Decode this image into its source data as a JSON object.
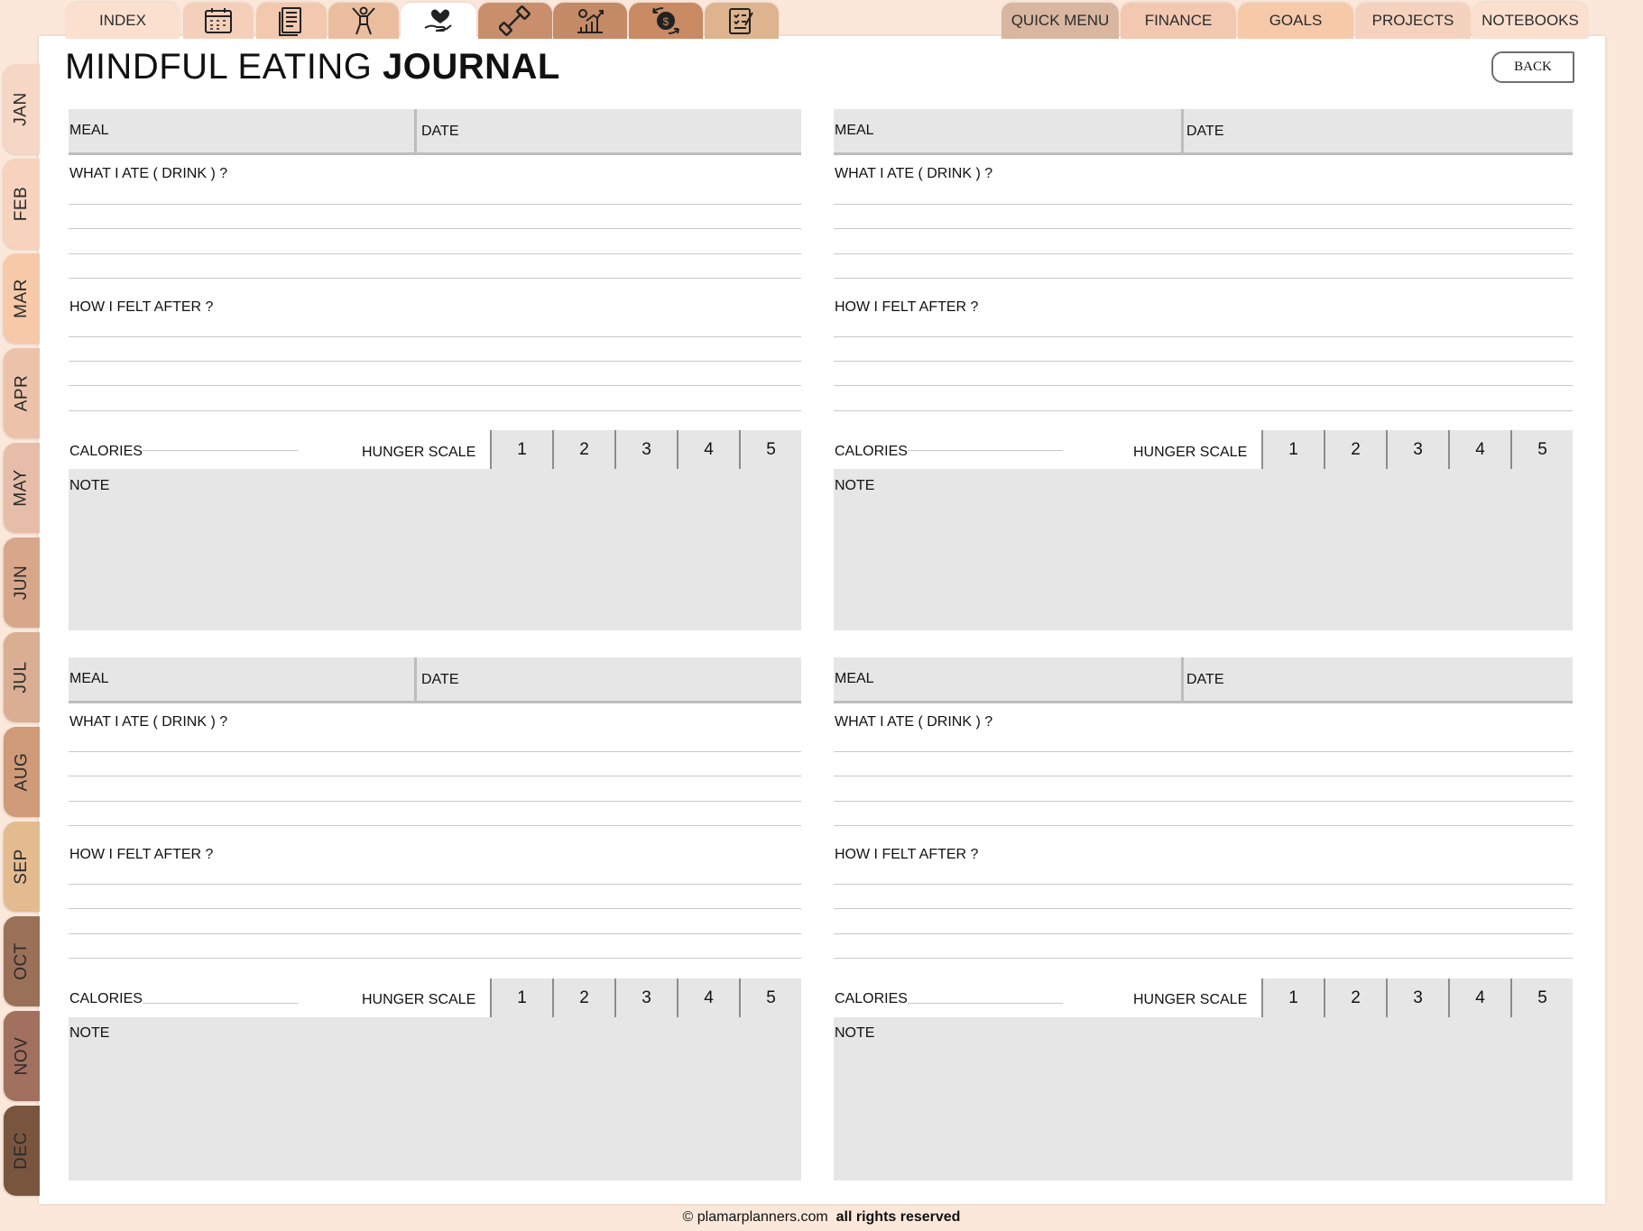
{
  "nav": {
    "index_label": "INDEX",
    "icon_tabs": [
      {
        "name": "calendar-icon",
        "color": "#f4d0bb"
      },
      {
        "name": "document-icon",
        "color": "#f2c8ae"
      },
      {
        "name": "fitness-person-icon",
        "color": "#ebbd9f"
      },
      {
        "name": "heart-hand-icon",
        "color": "#ffffff"
      },
      {
        "name": "dumbbell-icon",
        "color": "#c98f6c"
      },
      {
        "name": "growth-chart-icon",
        "color": "#c58a66"
      },
      {
        "name": "money-exchange-icon",
        "color": "#c98a64"
      },
      {
        "name": "checklist-icon",
        "color": "#ddb48e"
      }
    ],
    "right_tabs": [
      {
        "label": "QUICK MENU",
        "color": "#d9b6a0"
      },
      {
        "label": "FINANCE",
        "color": "#f2c9b0"
      },
      {
        "label": "GOALS",
        "color": "#f6c9a9"
      },
      {
        "label": "PROJECTS",
        "color": "#f5d2bd"
      },
      {
        "label": "NOTEBOOKS",
        "color": "#fbe0d0"
      }
    ]
  },
  "months": [
    {
      "label": "JAN",
      "color": "#f6d6c4"
    },
    {
      "label": "FEB",
      "color": "#f7d3bd"
    },
    {
      "label": "MAR",
      "color": "#f6c9a9"
    },
    {
      "label": "APR",
      "color": "#ecc3aa"
    },
    {
      "label": "MAY",
      "color": "#e6bda8"
    },
    {
      "label": "JUN",
      "color": "#d8a78b"
    },
    {
      "label": "JUL",
      "color": "#d9ae92"
    },
    {
      "label": "AUG",
      "color": "#cf9a77"
    },
    {
      "label": "SEP",
      "color": "#e3bb8f"
    },
    {
      "label": "OCT",
      "color": "#9b7058"
    },
    {
      "label": "NOV",
      "color": "#a2705f"
    },
    {
      "label": "DEC",
      "color": "#7a553e"
    }
  ],
  "title": {
    "light": "MINDFUL EATING",
    "bold": "JOURNAL"
  },
  "back_label": "BACK",
  "entry_labels": {
    "meal": "MEAL",
    "date": "DATE",
    "what_i_ate": "WHAT I ATE ( DRINK ) ?",
    "how_i_felt": "HOW I FELT AFTER ?",
    "calories": "CALORIES",
    "hunger_scale": "HUNGER SCALE",
    "scale_values": [
      "1",
      "2",
      "3",
      "4",
      "5"
    ],
    "note": "NOTE"
  },
  "footer": {
    "copyright": "© plamarplanners.com",
    "rights": "all rights reserved"
  }
}
